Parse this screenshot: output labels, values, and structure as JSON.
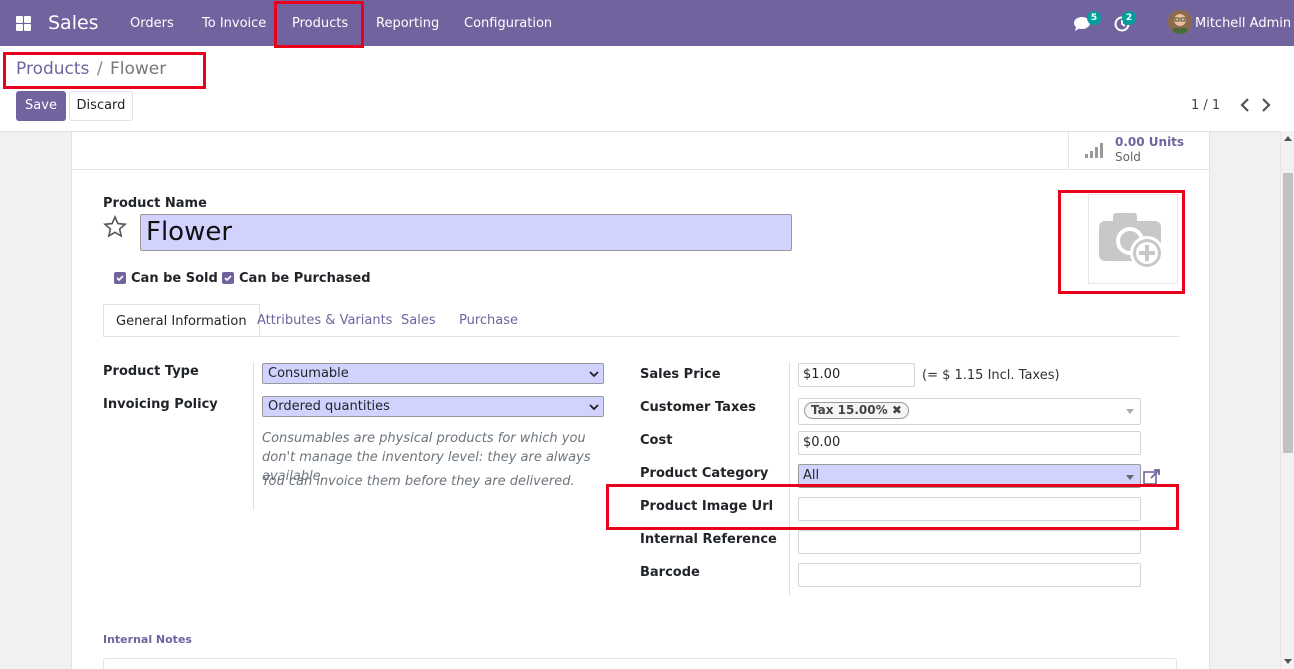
{
  "navbar": {
    "app_name": "Sales",
    "menu": [
      "Orders",
      "To Invoice",
      "Products",
      "Reporting",
      "Configuration"
    ],
    "active_menu": "Products",
    "messages_count": "5",
    "activities_count": "2",
    "user_name": "Mitchell Admin",
    "bg_color": "#71639e"
  },
  "breadcrumb": {
    "parent": "Products",
    "separator": "/",
    "current": "Flower"
  },
  "actions": {
    "save_label": "Save",
    "discard_label": "Discard"
  },
  "pager": {
    "value": "1 / 1",
    "prev_icon": "chevron-left-icon",
    "next_icon": "chevron-right-icon"
  },
  "stat_button": {
    "value": "0.00 Units",
    "label": "Sold",
    "icon": "bar-chart-icon"
  },
  "product": {
    "name_label": "Product Name",
    "name_value": "Flower",
    "can_be_sold_label": "Can be Sold",
    "can_be_purchased_label": "Can be Purchased",
    "can_be_sold": true,
    "can_be_purchased": true,
    "image_icon": "camera-add-icon"
  },
  "tabs": [
    "General Information",
    "Attributes & Variants",
    "Sales",
    "Purchase"
  ],
  "active_tab": "General Information",
  "left_fields": {
    "product_type_label": "Product Type",
    "product_type_value": "Consumable",
    "invoicing_policy_label": "Invoicing Policy",
    "invoicing_policy_value": "Ordered quantities",
    "help_1": "Consumables are physical products for which you don't manage the inventory level: they are always available.",
    "help_2": "You can invoice them before they are delivered."
  },
  "right_fields": {
    "sales_price_label": "Sales Price",
    "sales_price_value": "$1.00",
    "incl_taxes": "(= $ 1.15 Incl. Taxes)",
    "customer_taxes_label": "Customer Taxes",
    "customer_tax_tag": "Tax 15.00%",
    "cost_label": "Cost",
    "cost_value": "$0.00",
    "category_label": "Product Category",
    "category_value": "All",
    "image_url_label": "Product Image Url",
    "image_url_value": "",
    "internal_ref_label": "Internal Reference",
    "internal_ref_value": "",
    "barcode_label": "Barcode",
    "barcode_value": ""
  },
  "notes": {
    "label": "Internal Notes"
  },
  "colors": {
    "accent": "#71639e",
    "highlight_box": "#e8001c",
    "required_field": "#d2d2ff",
    "badge": "#00a09d"
  }
}
